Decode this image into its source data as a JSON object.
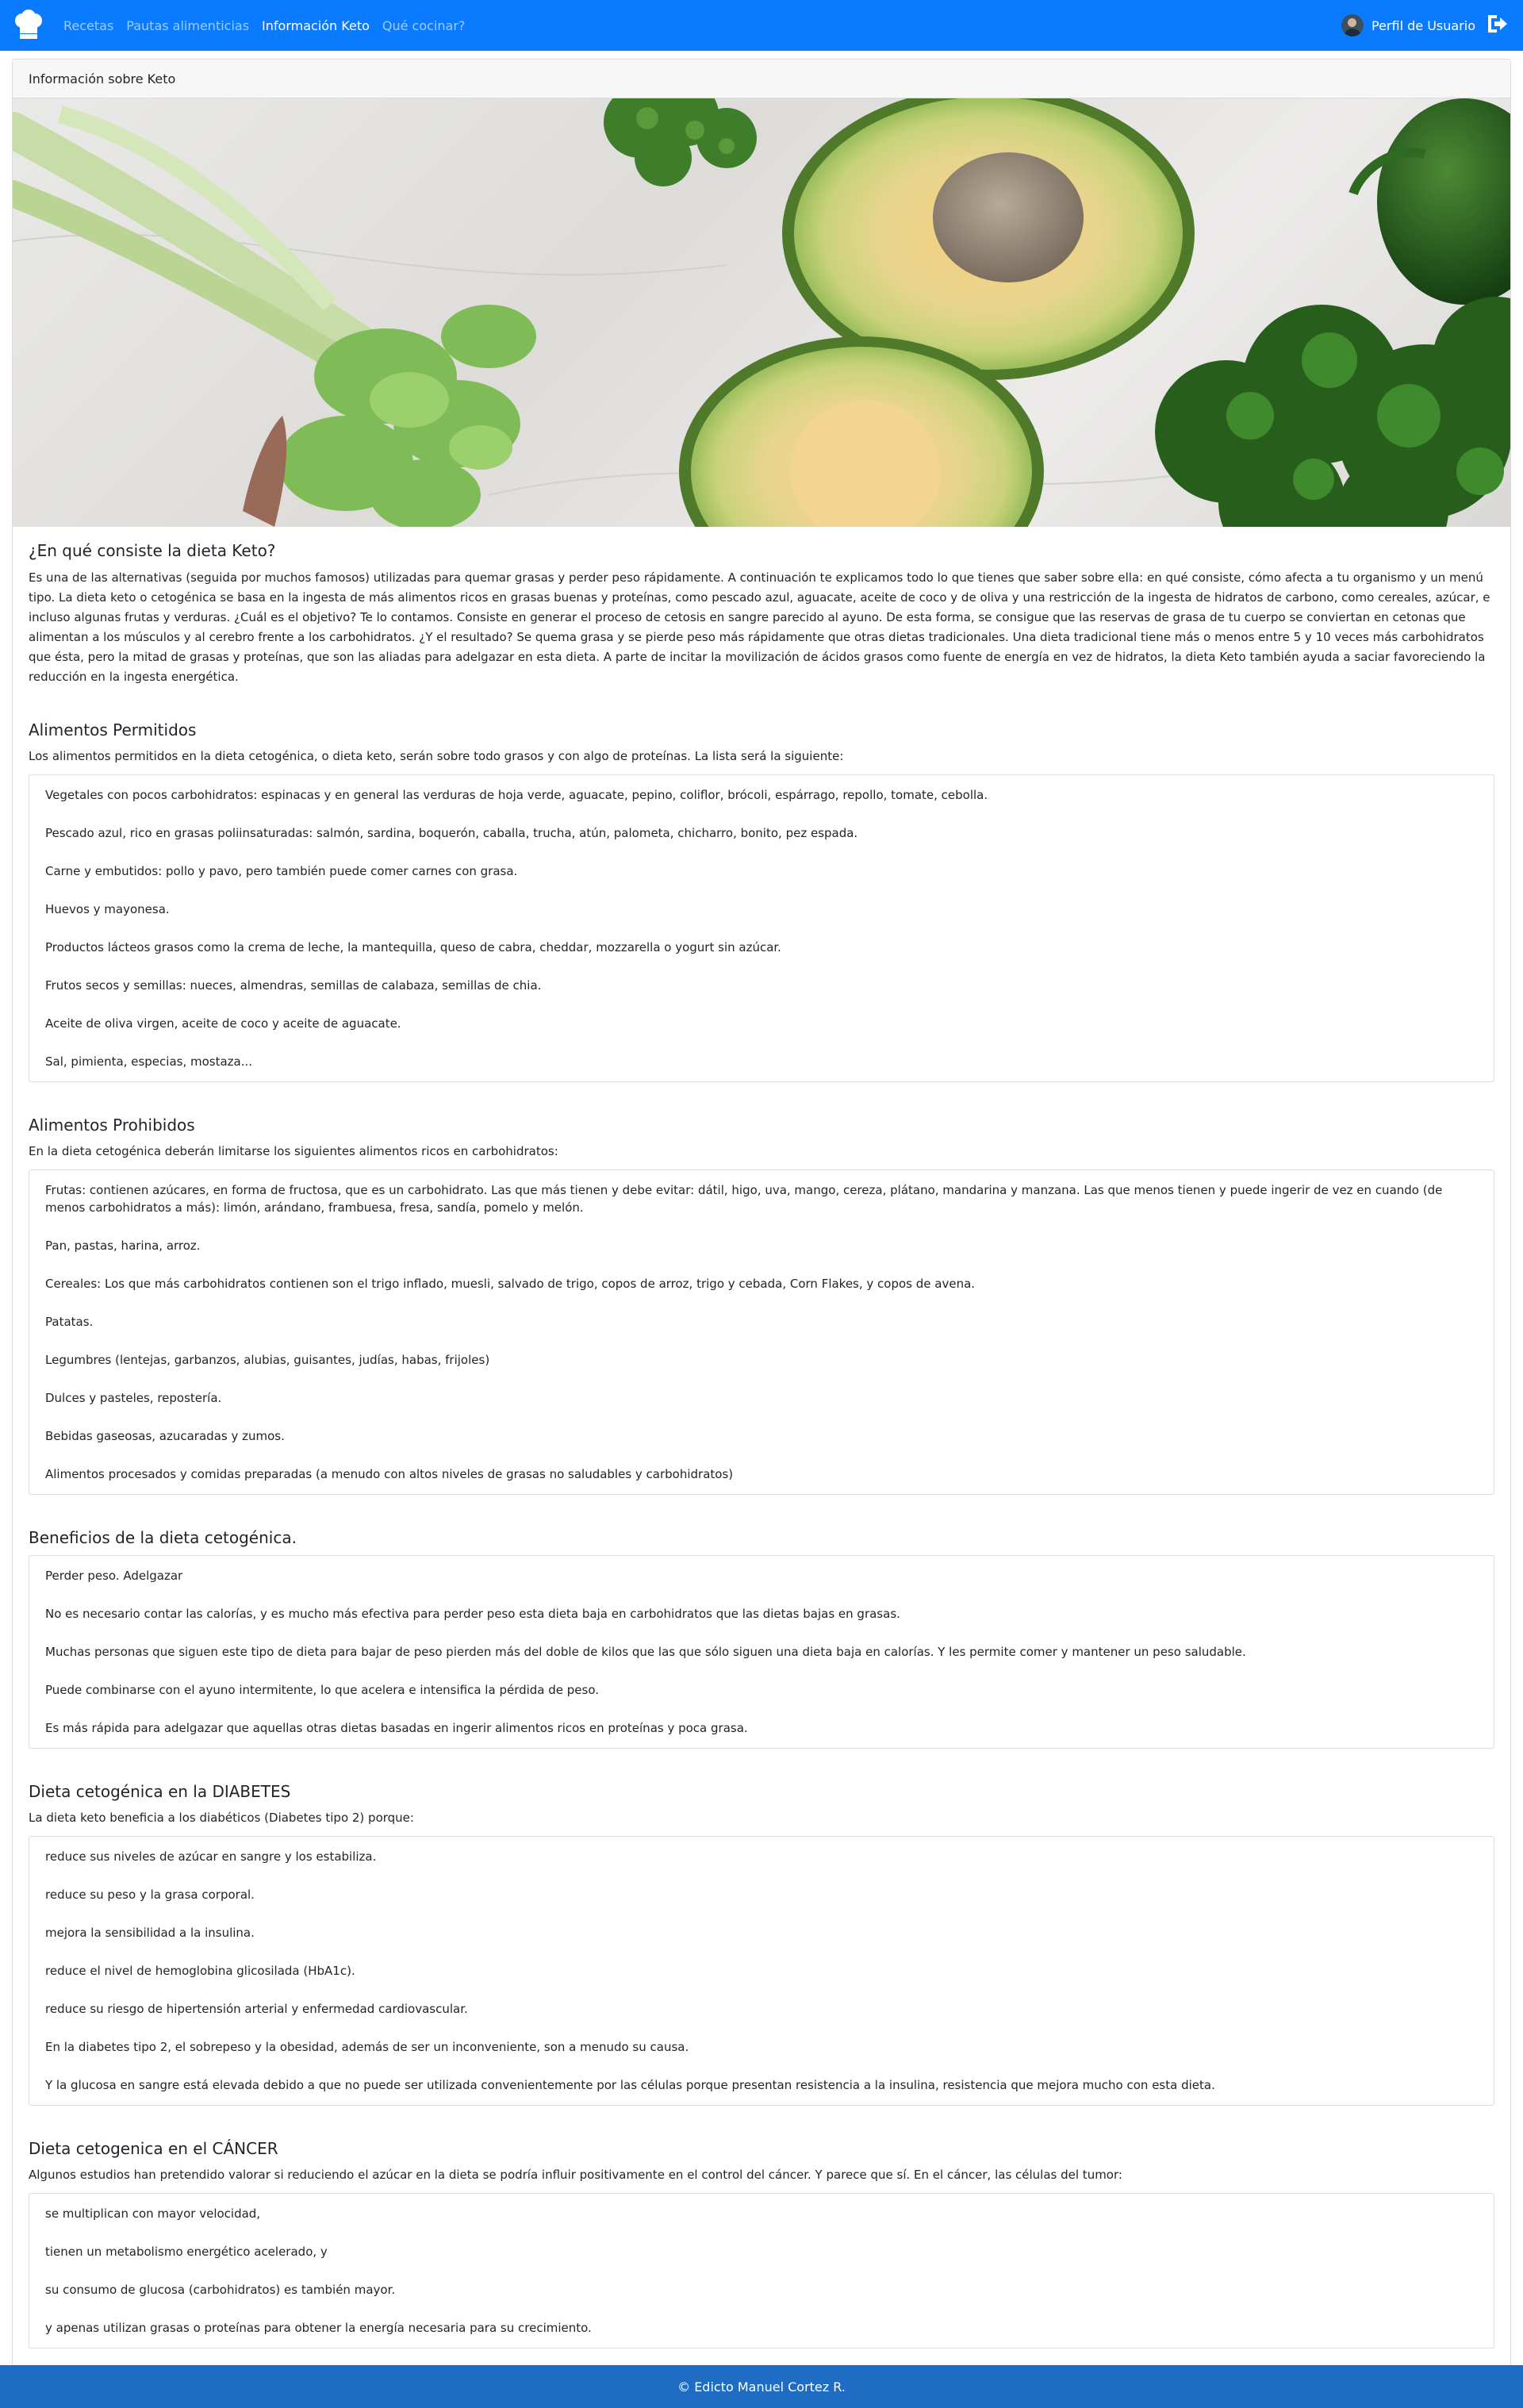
{
  "navbar": {
    "brand_icon": "chef-hat-icon",
    "links": [
      {
        "label": "Recetas",
        "active": false
      },
      {
        "label": "Pautas alimenticias",
        "active": false
      },
      {
        "label": "Información Keto",
        "active": true
      },
      {
        "label": "Qué cocinar?",
        "active": false
      }
    ],
    "profile_label": "Perfil de Usuario",
    "logout_icon": "logout-icon",
    "color": "#0a7bff"
  },
  "card": {
    "header": "Información sobre Keto",
    "hero_image": "avocado-vegetables-image"
  },
  "intro": {
    "title": "¿En qué consiste la dieta Keto?",
    "text": "Es una de las alternativas (seguida por muchos famosos) utilizadas para quemar grasas y perder peso rápidamente. A continuación te explicamos todo lo que tienes que saber sobre ella: en qué consiste, cómo afecta a tu organismo y un menú tipo. La dieta keto o cetogénica se basa en la ingesta de más alimentos ricos en grasas buenas y proteínas, como pescado azul, aguacate, aceite de coco y de oliva y una restricción de la ingesta de hidratos de carbono, como cereales, azúcar, e incluso algunas frutas y verduras. ¿Cuál es el objetivo? Te lo contamos. Consiste en generar el proceso de cetosis en sangre parecido al ayuno. De esta forma, se consigue que las reservas de grasa de tu cuerpo se conviertan en cetonas que alimentan a los músculos y al cerebro frente a los carbohidratos. ¿Y el resultado? Se quema grasa y se pierde peso más rápidamente que otras dietas tradicionales. Una dieta tradicional tiene más o menos entre 5 y 10 veces más carbohidratos que ésta, pero la mitad de grasas y proteínas, que son las aliadas para adelgazar en esta dieta. A parte de incitar la movilización de ácidos grasos como fuente de energía en vez de hidratos, la dieta Keto también ayuda a saciar favoreciendo la reducción en la ingesta energética."
  },
  "permitidos": {
    "title": "Alimentos Permitidos",
    "lead": "Los alimentos permitidos en la dieta cetogénica, o dieta keto, serán sobre todo grasos y con algo de proteínas. La lista será la siguiente:",
    "items": [
      "Vegetales con pocos carbohidratos: espinacas y en general las verduras de hoja verde, aguacate, pepino, coliflor, brócoli, espárrago, repollo, tomate, cebolla.",
      "Pescado azul, rico en grasas poliinsaturadas: salmón, sardina, boquerón, caballa, trucha, atún, palometa, chicharro, bonito, pez espada.",
      "Carne y embutidos: pollo y pavo, pero también puede comer carnes con grasa.",
      "Huevos y mayonesa.",
      "Productos lácteos grasos como la crema de leche, la mantequilla, queso de cabra, cheddar, mozzarella o yogurt sin azúcar.",
      "Frutos secos y semillas: nueces, almendras, semillas de calabaza, semillas de chia.",
      "Aceite de oliva virgen, aceite de coco y aceite de aguacate.",
      "Sal, pimienta, especias, mostaza..."
    ]
  },
  "prohibidos": {
    "title": "Alimentos Prohibidos",
    "lead": "En la dieta cetogénica deberán limitarse los siguientes alimentos ricos en carbohidratos:",
    "items": [
      "Frutas: contienen azúcares, en forma de fructosa, que es un carbohidrato. Las que más tienen y debe evitar: dátil, higo, uva, mango, cereza, plátano, mandarina y manzana. Las que menos tienen y puede ingerir de vez en cuando (de menos carbohidratos a más): limón, arándano, frambuesa, fresa, sandía, pomelo y melón.",
      "Pan, pastas, harina, arroz.",
      "Cereales: Los que más carbohidratos contienen son el trigo inflado, muesli, salvado de trigo, copos de arroz, trigo y cebada, Corn Flakes, y copos de avena.",
      "Patatas.",
      "Legumbres (lentejas, garbanzos, alubias, guisantes, judías, habas, frijoles)",
      "Dulces y pasteles, repostería.",
      "Bebidas gaseosas, azucaradas y zumos.",
      "Alimentos procesados y comidas preparadas (a menudo con altos niveles de grasas no saludables y carbohidratos)"
    ]
  },
  "beneficios": {
    "title": "Beneficios de la dieta cetogénica.",
    "items": [
      "Perder peso. Adelgazar",
      "No es necesario contar las calorías, y es mucho más efectiva para perder peso esta dieta baja en carbohidratos que las dietas bajas en grasas.",
      "Muchas personas que siguen este tipo de dieta para bajar de peso pierden más del doble de kilos que las que sólo siguen una dieta baja en calorías. Y les permite comer y mantener un peso saludable.",
      "Puede combinarse con el ayuno intermitente, lo que acelera e intensifica la pérdida de peso.",
      "Es más rápida para adelgazar que aquellas otras dietas basadas en ingerir alimentos ricos en proteínas y poca grasa."
    ]
  },
  "diabetes": {
    "title": "Dieta cetogénica en la DIABETES",
    "lead": "La dieta keto beneficia a los diabéticos (Diabetes tipo 2) porque:",
    "items": [
      "reduce sus niveles de azúcar en sangre y los estabiliza.",
      "reduce su peso y la grasa corporal.",
      "mejora la sensibilidad a la insulina.",
      "reduce el nivel de hemoglobina glicosilada (HbA1c).",
      "reduce su riesgo de hipertensión arterial y enfermedad cardiovascular.",
      "En la diabetes tipo 2, el sobrepeso y la obesidad, además de ser un inconveniente, son a menudo su causa.",
      "Y la glucosa en sangre está elevada debido a que no puede ser utilizada convenientemente por las células porque presentan resistencia a la insulina, resistencia que mejora mucho con esta dieta."
    ]
  },
  "cancer": {
    "title": "Dieta cetogenica en el CÁNCER",
    "lead": "Algunos estudios han pretendido valorar si reduciendo el azúcar en la dieta se podría influir positivamente en el control del cáncer. Y parece que sí. En el cáncer, las células del tumor:",
    "items": [
      "se multiplican con mayor velocidad,",
      "tienen un metabolismo energético acelerado, y",
      "su consumo de glucosa (carbohidratos) es también mayor.",
      "y apenas utilizan grasas o proteínas para obtener la energía necesaria para su crecimiento."
    ]
  },
  "footer": {
    "text": "© Edicto Manuel Cortez R.",
    "color": "#1f6cc4"
  }
}
